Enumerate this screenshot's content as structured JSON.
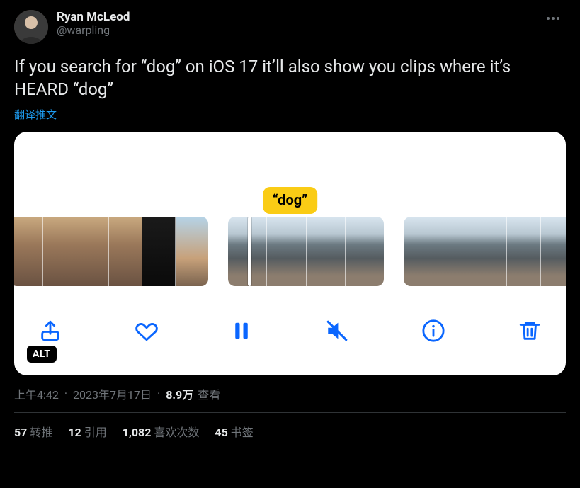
{
  "author": {
    "display_name": "Ryan McLeod",
    "handle": "@warpling"
  },
  "tweet_text": "If you search for “dog” on iOS 17 it’ll also show you clips where it’s HEARD “dog”",
  "translate_label": "翻译推文",
  "media": {
    "caption_bubble": "“dog”",
    "alt_badge": "ALT"
  },
  "meta": {
    "time": "上午4:42",
    "date": "2023年7月17日",
    "views_number": "8.9万",
    "views_label": "查看"
  },
  "stats": {
    "retweets_n": "57",
    "retweets_label": "转推",
    "quotes_n": "12",
    "quotes_label": "引用",
    "likes_n": "1,082",
    "likes_label": "喜欢次数",
    "bookmarks_n": "45",
    "bookmarks_label": "书签"
  }
}
